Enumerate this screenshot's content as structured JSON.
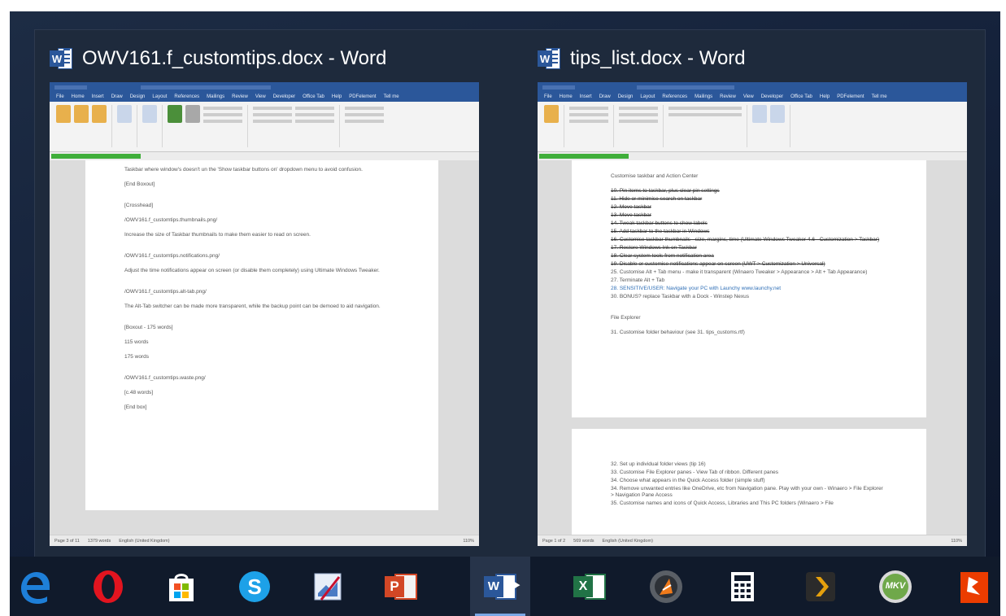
{
  "thumbnails": [
    {
      "title": "OWV161.f_customtips.docx - Word",
      "app_icon": "word-icon",
      "doc": {
        "ribbon_tabs": [
          "File",
          "Home",
          "Insert",
          "Draw",
          "Design",
          "Layout",
          "References",
          "Mailings",
          "Review",
          "View",
          "Developer",
          "Office Tab",
          "Help",
          "PDFelement",
          "Tell me"
        ],
        "body": [
          "Taskbar where window's doesn't un the 'Show taskbar buttons on' dropdown menu to avoid confusion.",
          "[End Boxout]",
          "[Crosshead]",
          "/OWV161.f_customtips.thumbnails.png/",
          "Increase the size of Taskbar thumbnails to make them easier to read on screen.",
          "/OWV161.f_customtips.notifications.png/",
          "Adjust the time notifications appear on screen (or disable them completely) using Ultimate Windows Tweaker.",
          "/OWV161.f_customtips.alt-tab.png/",
          "The Alt-Tab switcher can be made more transparent, while the backup point can be demoed to aid navigation.",
          "[Boxout - 175 words]",
          "115 words",
          "175 words",
          "/OWV161.f_customtips.waste.png/",
          "[c.48 words]",
          "[End box]"
        ],
        "status": [
          "Page 3 of 11",
          "1379 words",
          "English (United Kingdom)"
        ],
        "zoom": "110%"
      }
    },
    {
      "title": "tips_list.docx - Word",
      "app_icon": "word-icon",
      "doc": {
        "ribbon_tabs": [
          "File",
          "Home",
          "Insert",
          "Draw",
          "Design",
          "Layout",
          "References",
          "Mailings",
          "Review",
          "View",
          "Developer",
          "Office Tab",
          "Help",
          "PDFelement",
          "Tell me"
        ],
        "section1_heading": "Customise taskbar and Action Center",
        "section1_items": [
          "10. Pin items to taskbar, plus clear pin settings",
          "11. Hide or minimise search on taskbar",
          "12. Move taskbar",
          "13. Move taskbar",
          "14. Tweak taskbar buttons to show labels",
          "15. Add taskbar to the taskbar in Windows",
          "16. Customise taskbar thumbnails - size, margins, time (Ultimate Windows Tweaker 4.6 - Customization > Taskbar)",
          "17. Restore Windows Ink on Taskbar",
          "18. Clear system tools from notification area",
          "19. Disable or customise notifications appear on screen (UWT > Customization > Universal)",
          "25. Customise Alt + Tab menu - make it transparent (Winaero Tweaker > Appearance > Alt + Tab Appearance)",
          "27. Terminate Alt + Tab",
          "28. SENSITIVE/USER: Navigate your PC with Launchy www.launchy.net",
          "30. BONUS? replace Taskbar with a Dock - Winstep Nexus"
        ],
        "section2_heading": "File Explorer",
        "section2_items": [
          "31. Customise folder behaviour (see 31. tips_customs.rtf)"
        ],
        "page2_items": [
          "32. Set up individual folder views (tip 16)",
          "33. Customise File Explorer panes - View Tab of ribbon. Different panes",
          "34. Choose what appears in the Quick Access folder (simple stuff)",
          "34. Remove unwanted entries like OneDrive, etc from Navigation pane. Play with your own - Winaero > File Explorer > Navigation Pane Access",
          "35. Customise names and icons of Quick Access, Libraries and This PC folders (Winaero > File"
        ],
        "status": [
          "Page 1 of 2",
          "569 words",
          "English (United Kingdom)"
        ],
        "zoom": "110%"
      }
    }
  ],
  "taskbar": {
    "items": [
      {
        "name": "edge-icon",
        "active": false
      },
      {
        "name": "opera-icon",
        "active": false
      },
      {
        "name": "store-icon",
        "active": false
      },
      {
        "name": "skype-icon",
        "active": false
      },
      {
        "name": "paint-icon",
        "active": false
      },
      {
        "name": "powerpoint-icon",
        "active": false
      },
      {
        "name": "word-icon",
        "active": true
      },
      {
        "name": "excel-icon",
        "active": false
      },
      {
        "name": "media-app-icon",
        "active": false
      },
      {
        "name": "calculator-icon",
        "active": false
      },
      {
        "name": "plex-icon",
        "active": false
      },
      {
        "name": "mkv-icon",
        "active": false
      },
      {
        "name": "office-app-icon",
        "active": false
      }
    ],
    "labels": {
      "powerpoint": "P",
      "word": "W",
      "excel": "X",
      "mkv": "MKV"
    }
  },
  "colors": {
    "word_blue": "#2b579a",
    "taskbar": "#101a2b",
    "active_highlight": "#27344a"
  }
}
